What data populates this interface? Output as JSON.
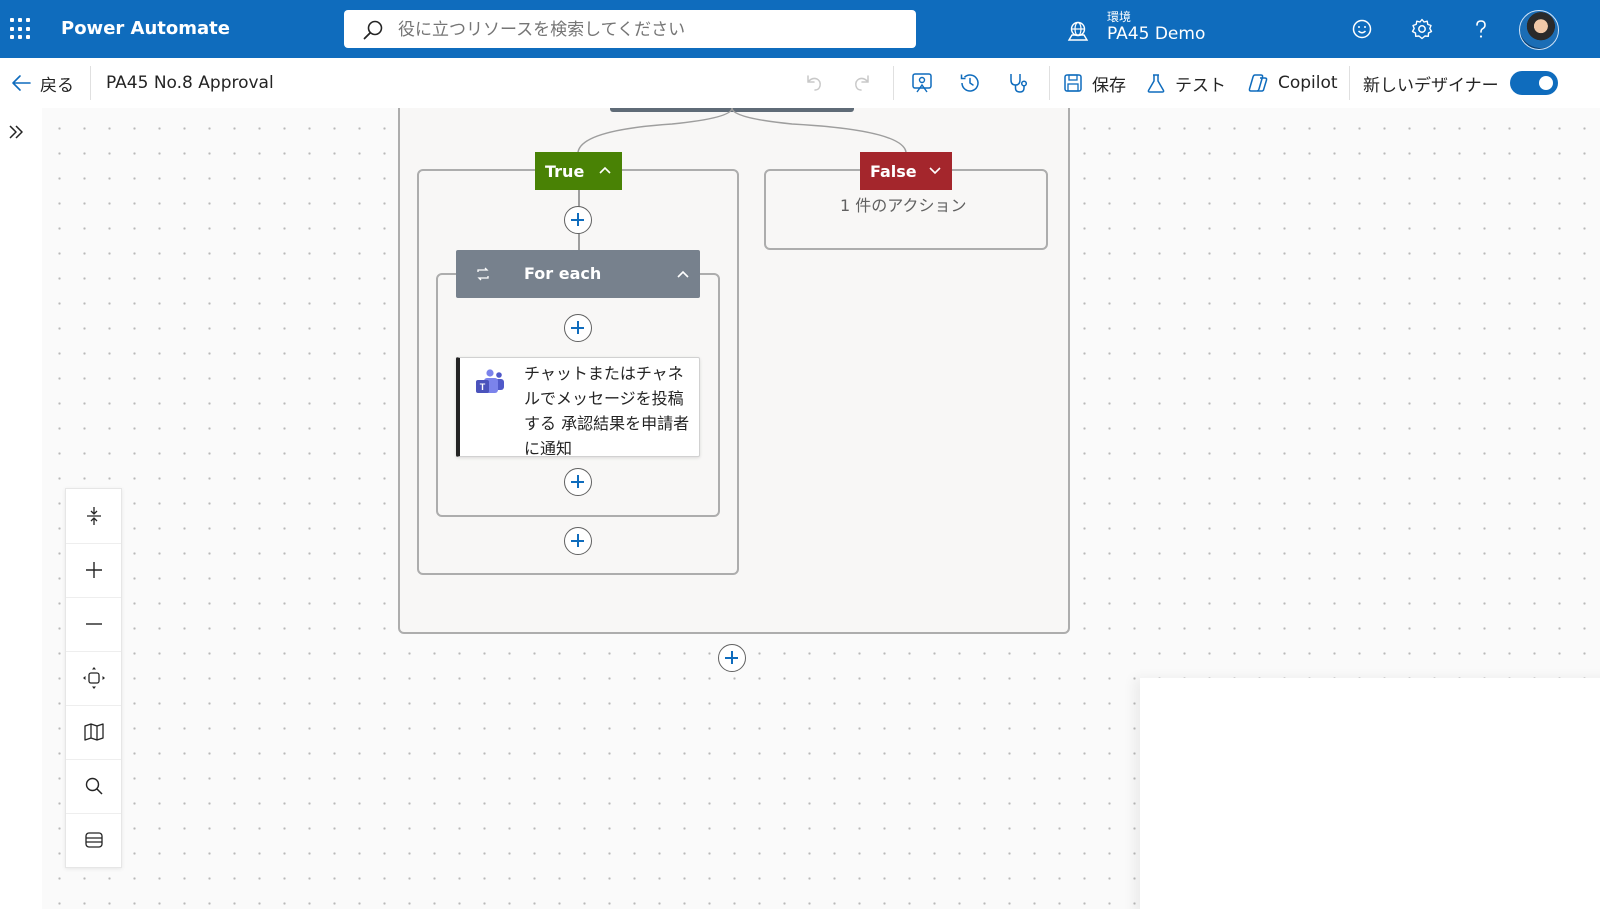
{
  "header": {
    "app_name": "Power Automate",
    "search_placeholder": "役に立つリソースを検索してください",
    "environment_label": "環境",
    "environment_name": "PA45 Demo"
  },
  "commandbar": {
    "back_label": "戻る",
    "flow_name": "PA45 No.8 Approval",
    "save_label": "保存",
    "test_label": "テスト",
    "copilot_label": "Copilot",
    "new_designer_label": "新しいデザイナー",
    "new_designer_on": true
  },
  "flow": {
    "true_label": "True",
    "false_label": "False",
    "false_count": "1 件のアクション",
    "foreach_label": "For each",
    "action_label": "チャットまたはチャネルでメッセージを投稿する 承認結果を申請者に通知"
  },
  "colors": {
    "header_blue": "#0f6cbd",
    "true_green": "#498205",
    "false_red": "#a4262c",
    "foreach_gray": "#77818d"
  }
}
